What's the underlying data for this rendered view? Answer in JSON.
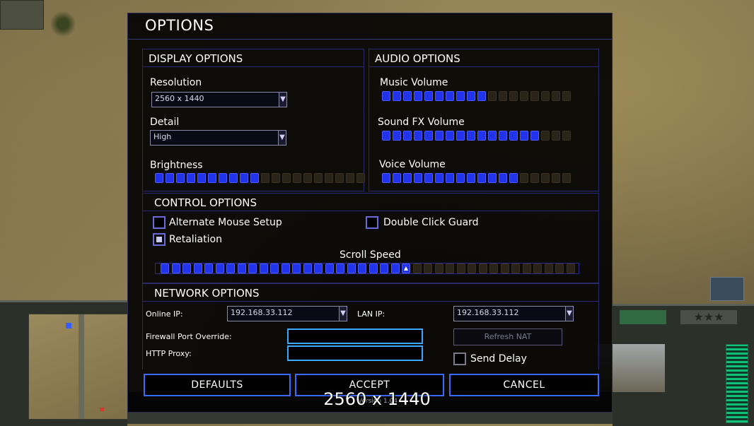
{
  "window": {
    "title": "OPTIONS"
  },
  "display": {
    "header": "DISPLAY OPTIONS",
    "resolution_label": "Resolution",
    "resolution_value": "2560 x 1440",
    "detail_label": "Detail",
    "detail_value": "High",
    "brightness_label": "Brightness",
    "brightness_level": 10,
    "brightness_max": 20
  },
  "audio": {
    "header": "AUDIO OPTIONS",
    "music_label": "Music Volume",
    "music_level": 10,
    "sfx_label": "Sound FX Volume",
    "sfx_level": 15,
    "voice_label": "Voice Volume",
    "voice_level": 13,
    "volume_max": 18
  },
  "control": {
    "header": "CONTROL OPTIONS",
    "alt_mouse_label": "Alternate Mouse Setup",
    "alt_mouse_checked": false,
    "double_click_label": "Double Click Guard",
    "double_click_checked": false,
    "retaliation_label": "Retaliation",
    "retaliation_checked": true,
    "scroll_label": "Scroll Speed",
    "scroll_level": 23,
    "scroll_max": 38
  },
  "network": {
    "header": "NETWORK OPTIONS",
    "online_ip_label": "Online IP:",
    "online_ip_value": "192.168.33.112",
    "lan_ip_label": "LAN IP:",
    "lan_ip_value": "192.168.33.112",
    "firewall_label": "Firewall Port Override:",
    "http_proxy_label": "HTTP Proxy:",
    "refresh_nat_label": "Refresh NAT",
    "send_delay_label": "Send Delay",
    "send_delay_checked": false
  },
  "buttons": {
    "defaults": "DEFAULTS",
    "accept": "ACCEPT",
    "cancel": "CANCEL"
  },
  "overlay": {
    "caption": "2560 x 1440",
    "version": "Version 1.04"
  },
  "colors": {
    "accent": "#3a6aff",
    "slider_on": "#2233ee",
    "input_border": "#3aa8ff"
  }
}
